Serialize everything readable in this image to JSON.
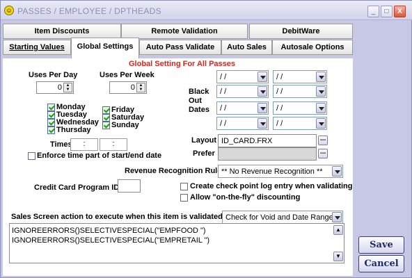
{
  "window": {
    "title": "PASSES / EMPLOYEE / DPTHEADS",
    "minimize": "_",
    "maximize": "□",
    "close": "X"
  },
  "tabs_row1": [
    "Item Discounts",
    "Remote Validation",
    "DebitWare"
  ],
  "tabs_row2": [
    "Starting Values",
    "Global Settings",
    "Auto Pass Validate",
    "Auto Sales",
    "Autosale Options"
  ],
  "active_tab": "Global Settings",
  "global": {
    "heading": "Global Setting For All Passes",
    "uses_per_day_label": "Uses Per Day",
    "uses_per_day": "0",
    "uses_per_week_label": "Uses Per Week",
    "uses_per_week": "0",
    "days": [
      {
        "label": "Monday",
        "checked": true
      },
      {
        "label": "Tuesday",
        "checked": true
      },
      {
        "label": "Wednesday",
        "checked": true
      },
      {
        "label": "Thursday",
        "checked": true
      },
      {
        "label": "Friday",
        "checked": true
      },
      {
        "label": "Saturday",
        "checked": true
      },
      {
        "label": "Sunday",
        "checked": true
      }
    ],
    "times_label": "Times",
    "time_start": ":",
    "time_end": ":",
    "enforce_label": "Enforce time part of start/end date",
    "enforce_checked": false,
    "black_out_label_1": "Black",
    "black_out_label_2": "Out",
    "black_out_label_3": "Dates",
    "blackout_dates": [
      "/ /",
      "/ /",
      "/ /",
      "/ /",
      "/ /",
      "/ /",
      "/ /",
      "/ /"
    ],
    "layout_label": "Layout",
    "layout_value": "ID_CARD.FRX",
    "prefer_label": "Prefer",
    "prefer_value": "",
    "revenue_label": "Revenue Recognition Rule",
    "revenue_value": "** No Revenue Recognition **",
    "credit_label": "Credit Card Program ID",
    "credit_value": "",
    "checkpoint_label": "Create check point log entry when validating",
    "checkpoint_checked": false,
    "onthefly_label": "Allow \"on-the-fly\" discounting",
    "onthefly_checked": false,
    "sales_action_label": "Sales Screen action to execute when this item is validated",
    "sales_action_value": "Check for Void and Date Range",
    "script_lines": [
      "IGNOREERRORS()SELECTIVESPECIAL(\"EMPFOOD  \")",
      "IGNOREERRORS()SELECTIVESPECIAL(\"EMPRETAIL   \")"
    ]
  },
  "buttons": {
    "save": "Save",
    "cancel": "Cancel"
  },
  "colors": {
    "heading": "#e0201b",
    "background": "#c7c8e6",
    "check": "#1f9a1f"
  }
}
